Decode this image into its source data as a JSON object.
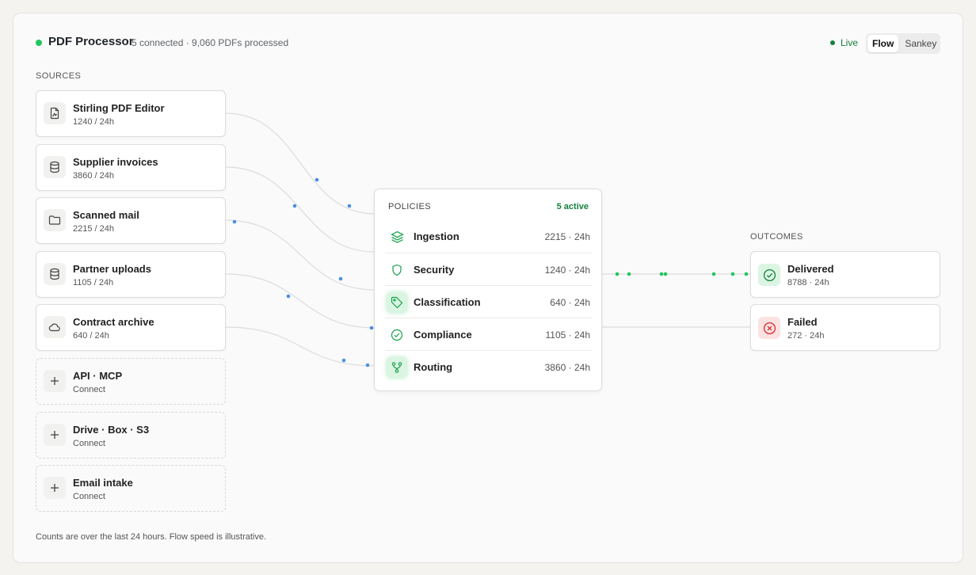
{
  "header": {
    "title": "PDF Processor",
    "subtitle": "5 connected · 9,060 PDFs processed",
    "live_label": "Live",
    "view_toggle": [
      {
        "label": "Flow",
        "active": true
      },
      {
        "label": "Sankey",
        "active": false
      }
    ]
  },
  "sources": {
    "label": "SOURCES",
    "items": [
      {
        "name": "Stirling PDF Editor",
        "rate": "1240 / 24h",
        "icon": "pdf-file-icon"
      },
      {
        "name": "Supplier invoices",
        "rate": "3860 / 24h",
        "icon": "database-icon"
      },
      {
        "name": "Scanned mail",
        "rate": "2215 / 24h",
        "icon": "folder-icon"
      },
      {
        "name": "Partner uploads",
        "rate": "1105 / 24h",
        "icon": "database-icon"
      },
      {
        "name": "Contract archive",
        "rate": "640 / 24h",
        "icon": "cloud-icon"
      }
    ],
    "connectors": [
      {
        "name": "API · MCP",
        "action": "Connect",
        "icon": "plus-icon"
      },
      {
        "name": "Drive · Box · S3",
        "action": "Connect",
        "icon": "plus-icon"
      },
      {
        "name": "Email intake",
        "action": "Connect",
        "icon": "plus-icon"
      }
    ]
  },
  "policies": {
    "label": "POLICIES",
    "active_label": "5 active",
    "items": [
      {
        "name": "Ingestion",
        "value": "2215 · 24h",
        "icon": "layers-icon"
      },
      {
        "name": "Security",
        "value": "1240 · 24h",
        "icon": "shield-icon"
      },
      {
        "name": "Classification",
        "value": "640 · 24h",
        "icon": "tag-icon"
      },
      {
        "name": "Compliance",
        "value": "1105 · 24h",
        "icon": "check-circle-icon"
      },
      {
        "name": "Routing",
        "value": "3860 · 24h",
        "icon": "branch-icon"
      }
    ]
  },
  "outcomes": {
    "label": "OUTCOMES",
    "items": [
      {
        "name": "Delivered",
        "value": "8788 · 24h",
        "icon": "check-circle-icon"
      },
      {
        "name": "Failed",
        "value": "272 · 24h",
        "icon": "x-circle-icon"
      }
    ]
  },
  "footer": "Counts are over the last 24 hours. Flow speed is illustrative.",
  "colors": {
    "accent_green": "#22c55e",
    "live_green": "#15803d",
    "flow_blue": "#4a90e2",
    "failed_red": "#dc2626"
  }
}
